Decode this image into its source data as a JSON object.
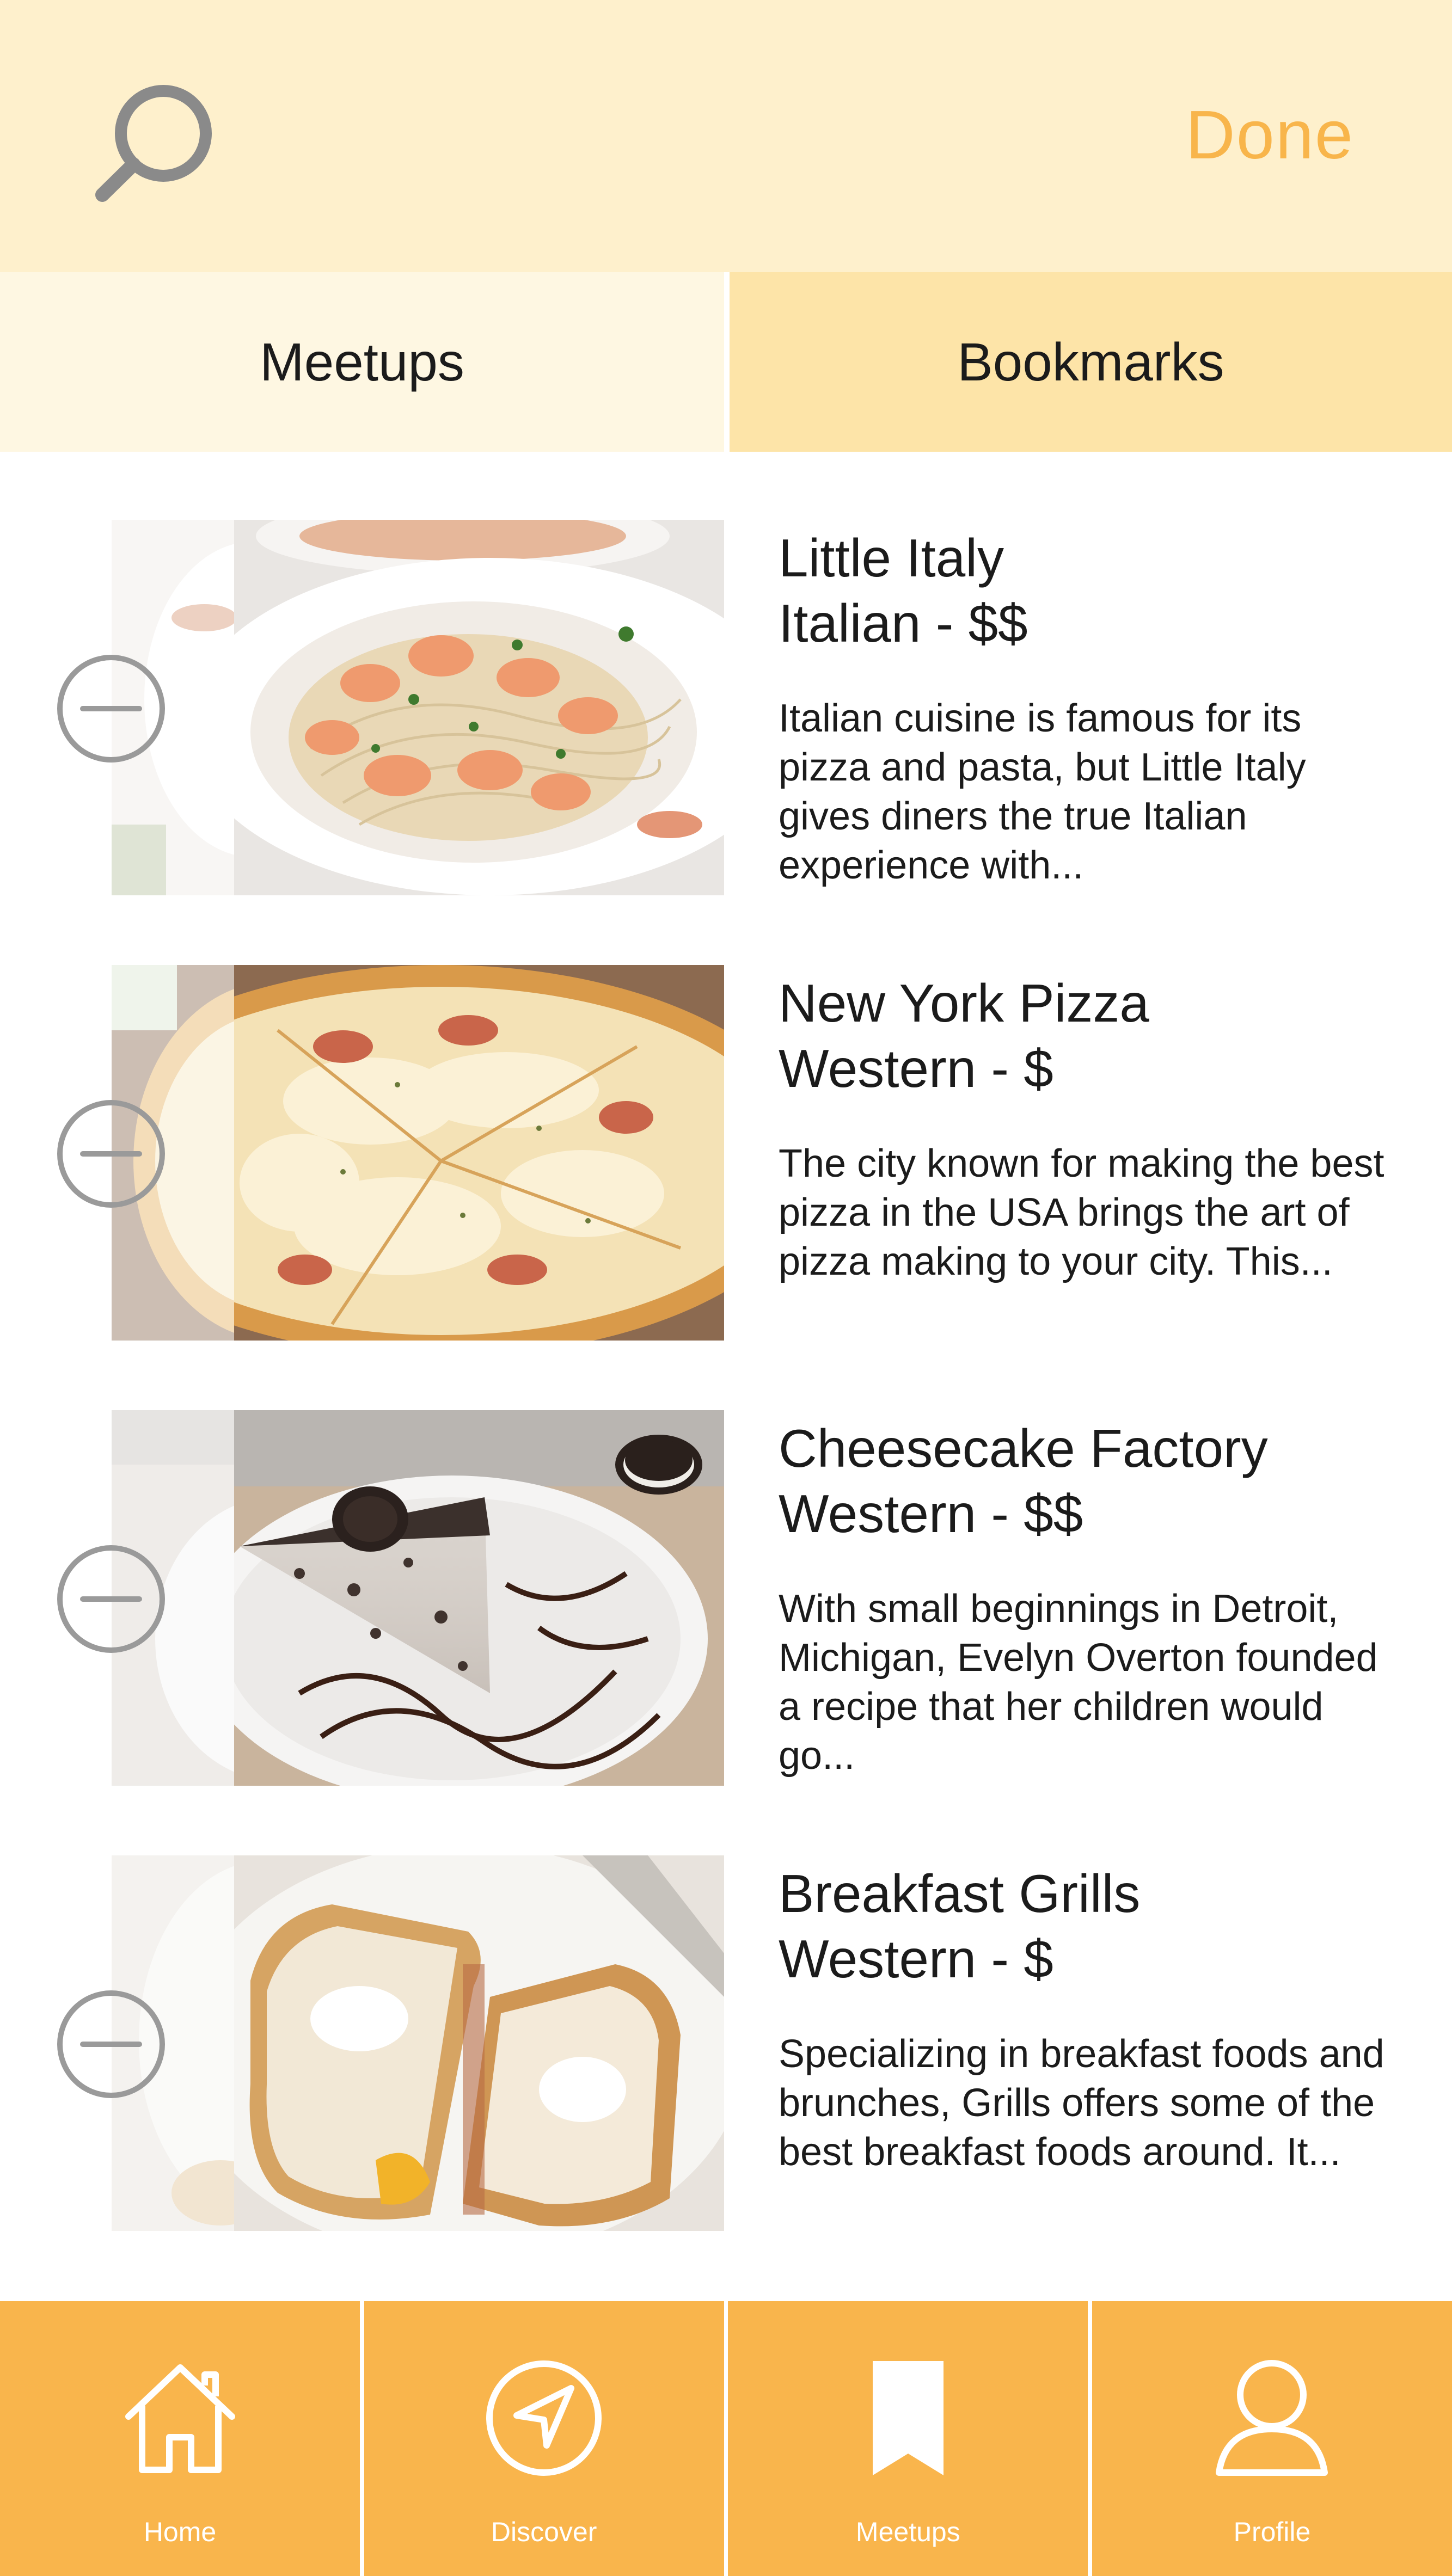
{
  "header": {
    "search_icon": "search-icon",
    "done_label": "Done"
  },
  "tabs": [
    {
      "label": "Meetups",
      "active": false
    },
    {
      "label": "Bookmarks",
      "active": true
    }
  ],
  "bookmarks": [
    {
      "title": "Little Italy",
      "subtitle": "Italian - $$",
      "description": "Italian cuisine is famous for its pizza and pasta, but Little Italy gives diners the true Italian experience with...",
      "image": "shrimp-pasta-photo"
    },
    {
      "title": "New York Pizza",
      "subtitle": "Western - $",
      "description": "The city known for making the best pizza in the USA brings the art of pizza making to your city. This...",
      "image": "pepperoni-pizza-photo"
    },
    {
      "title": "Cheesecake Factory",
      "subtitle": "Western - $$",
      "description": "With small beginnings in Detroit, Michigan, Evelyn Overton founded a recipe that her children would go...",
      "image": "oreo-cheesecake-photo"
    },
    {
      "title": "Breakfast Grills",
      "subtitle": "Western - $",
      "description": "Specializing in breakfast foods and brunches, Grills offers some of the best breakfast foods around. It...",
      "image": "egg-toast-sandwich-photo"
    }
  ],
  "nav": [
    {
      "label": "Home",
      "icon": "home-icon"
    },
    {
      "label": "Discover",
      "icon": "compass-icon"
    },
    {
      "label": "Meetups",
      "icon": "bookmark-icon"
    },
    {
      "label": "Profile",
      "icon": "profile-icon"
    }
  ],
  "colors": {
    "header_bg": "#fef0cc",
    "accent": "#f8b54b",
    "nav_bg": "#f9b54c",
    "tab_inactive": "#fef7e2",
    "tab_active": "#fde4a8"
  }
}
